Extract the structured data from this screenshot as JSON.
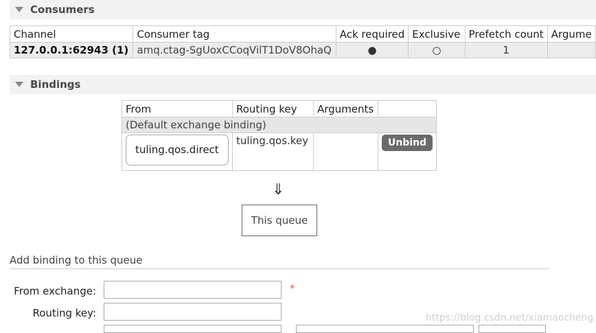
{
  "consumers": {
    "title": "Consumers",
    "columns": [
      "Channel",
      "Consumer tag",
      "Ack required",
      "Exclusive",
      "Prefetch count",
      "Argume"
    ],
    "rows": [
      {
        "channel": "127.0.0.1:62943 (1)",
        "consumer_tag": "amq.ctag-SgUoxCCoqVilT1DoV8OhaQ",
        "ack_required": "●",
        "exclusive": "○",
        "prefetch_count": "1",
        "arguments": ""
      }
    ]
  },
  "bindings": {
    "title": "Bindings",
    "columns": [
      "From",
      "Routing key",
      "Arguments",
      ""
    ],
    "default_binding": "(Default exchange binding)",
    "rows": [
      {
        "from": "tuling.qos.direct",
        "routing_key": "tuling.qos.key",
        "arguments": "",
        "unbind_label": "Unbind"
      }
    ],
    "arrow": "⇓",
    "this_queue": "This queue"
  },
  "add_binding": {
    "title": "Add binding to this queue",
    "from_exchange_label": "From exchange:",
    "routing_key_label": "Routing key:",
    "required_mark": "*",
    "from_exchange_value": "",
    "routing_key_value": ""
  },
  "watermark": "https://blog.csdn.net/xiamaocheng"
}
